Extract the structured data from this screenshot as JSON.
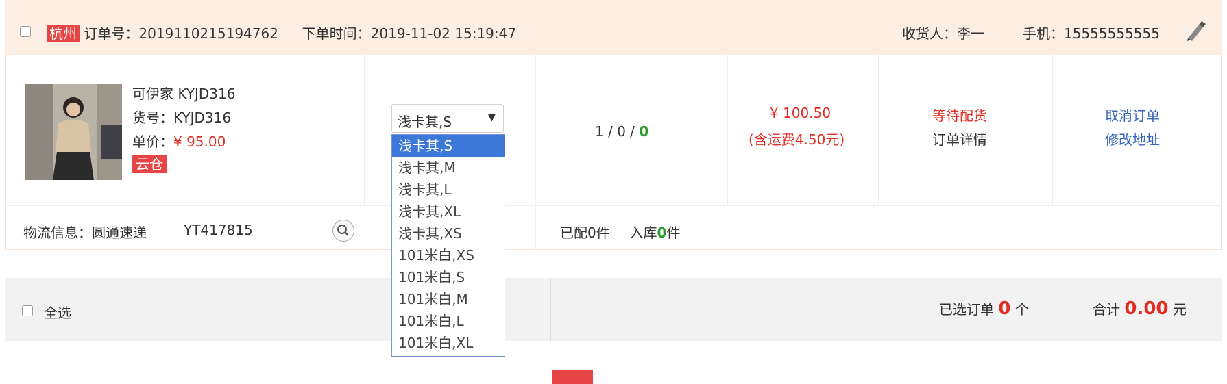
{
  "order": {
    "city": "杭州",
    "order_no": "订单号：2019110215194762",
    "order_time": "下单时间：2019-11-02 15:19:47",
    "receiver": "收货人：李一",
    "phone": "手机：15555555555"
  },
  "product": {
    "name": "可伊家 KYJD316",
    "sku": "货号：KYJD316",
    "price_label": "单价：",
    "price": "¥ 95.00",
    "warehouse_tag": "云仓"
  },
  "variant_select": {
    "value": "浅卡其,S",
    "options": [
      "浅卡其,S",
      "浅卡其,M",
      "浅卡其,L",
      "浅卡其,XL",
      "浅卡其,XS",
      "101米白,XS",
      "101米白,S",
      "101米白,M",
      "101米白,L",
      "101米白,XL"
    ]
  },
  "quantity": {
    "a": "1",
    "sep": "/",
    "b": "0",
    "c": "0"
  },
  "amount": {
    "total": "¥ 100.50",
    "shipping": "(含运费4.50元)"
  },
  "status": {
    "state": "等待配货",
    "detail_link": "订单详情"
  },
  "actions": {
    "cancel": "取消订单",
    "edit_address": "修改地址"
  },
  "logistics": {
    "label": "物流信息：圆通速递",
    "tracking": "YT417815",
    "allocated_prefix": "已配",
    "allocated_count": "0",
    "allocated_suffix": "件",
    "stocked_prefix": "入库",
    "stocked_count": "0",
    "stocked_suffix": "件"
  },
  "footer": {
    "select_all": "全选",
    "selected_prefix": "已选订单",
    "selected_count": "0",
    "selected_suffix": "个",
    "total_prefix": "合计",
    "total_value": "0.00",
    "total_suffix": "元"
  },
  "colors": {
    "accent_red": "#e02e24",
    "link_blue": "#3865b8",
    "header_bg": "#fdeee4",
    "select_highlight": "#3b78d8"
  }
}
